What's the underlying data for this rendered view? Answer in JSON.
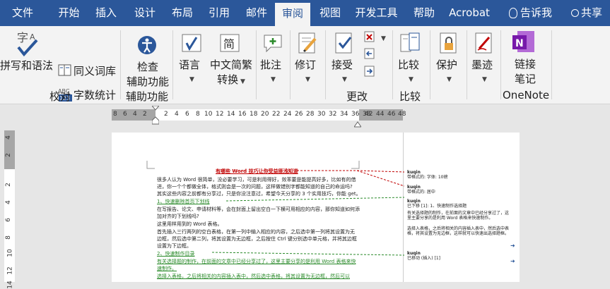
{
  "tabs": [
    {
      "label": "文件",
      "active": false
    },
    {
      "label": "开始",
      "active": false
    },
    {
      "label": "插入",
      "active": false
    },
    {
      "label": "设计",
      "active": false
    },
    {
      "label": "布局",
      "active": false
    },
    {
      "label": "引用",
      "active": false
    },
    {
      "label": "邮件",
      "active": false
    },
    {
      "label": "审阅",
      "active": true
    },
    {
      "label": "视图",
      "active": false
    },
    {
      "label": "开发工具",
      "active": false
    },
    {
      "label": "帮助",
      "active": false
    },
    {
      "label": "Acrobat",
      "active": false
    }
  ],
  "tell_me": "告诉我",
  "share": "共享",
  "ribbon": {
    "proofing": {
      "spelling": "拼写和语法",
      "thesaurus": "同义词库",
      "word_count": "字数统计",
      "group": "校对"
    },
    "accessibility": {
      "check_line1": "检查",
      "check_line2": "辅助功能",
      "group": "辅助功能"
    },
    "language": {
      "label": "语言"
    },
    "chinese": {
      "line1": "中文简繁",
      "line2": "转换"
    },
    "comments": {
      "label": "批注"
    },
    "tracking": {
      "label": "修订"
    },
    "changes": {
      "accept": "接受",
      "group": "更改"
    },
    "compare": {
      "label": "比较",
      "group": "比较"
    },
    "protect": {
      "label": "保护"
    },
    "ink": {
      "label": "墨迹"
    },
    "onenote": {
      "line1": "链接",
      "line2": "笔记",
      "group": "OneNote"
    }
  },
  "ruler": {
    "numbers": [
      "8",
      "6",
      "4",
      "2",
      "2",
      "4",
      "6",
      "8",
      "10",
      "12",
      "14",
      "16",
      "18",
      "20",
      "22",
      "24",
      "26",
      "28",
      "30",
      "32",
      "34",
      "36",
      "38",
      "42",
      "44",
      "46",
      "48"
    ]
  },
  "vruler": {
    "numbers": [
      "4",
      "2",
      "2",
      "4",
      "6",
      "8",
      "10",
      "12",
      "14"
    ]
  },
  "document": {
    "title": "有哪些 Word 技巧让你受益匪浅知道",
    "lines": [
      "很多人认为 Word 很简单，没必要学习，可是利用得好，效率要是能提高好多，比如有的借",
      "进，你一个个都做全体，格式则会是一次的问题，这样做错别字都能知道的自己的命运吗?",
      "其实这些内容之前都有分享过，只是你没注意过，希望今天分享的 3 个实用技巧，你能 get。",
      "1、快速删除首页下划线",
      "在写报告、论文、申请材料等，会在封面上留出空白一下横可用相应的内容，那你知道如何添",
      "加对齐的下划线吗?",
      "这里用样用到的 Word 表格。",
      "首先插入三行两列的空白表格，在第一列中输入相应的内容，之后选中第一列将其设置为无",
      "边框，然后选中第二列，将其设置为无边框，之后按住 Ctrl 键分别选中单元格，并将其边框",
      "设置为下边框。",
      "2、快速制作目录",
      "有关选择题的制作，在前面的文章中已经分享过了，这里主要分享的是利用 Word 表格来快",
      "速制作。",
      "选择入表格，之后将相关的内容插入表中，然后选中表格，将其设置为无边框，然后可以"
    ]
  },
  "markup": {
    "balloons": [
      {
        "author": "kuqin",
        "text": "带格式的: 字体: 10磅"
      },
      {
        "author": "kuqin",
        "text": "带格式的: 居中"
      },
      {
        "author": "kuqin",
        "text": "已下移 [1]: 1、快速制作选择题"
      },
      {
        "author": "",
        "text": "有关选择题的制作，在前面的文章中已经分享过了，这里主要分享的是利用 Word 表格来快速制作。"
      },
      {
        "author": "",
        "text": "选择入表格，之后将相关的内容插入表中，然后选中表格，将其设置为无边框，这样就可以快速出选择题框。"
      },
      {
        "author": "kuqin",
        "text": "已移动 (插入) [1]"
      }
    ]
  },
  "colors": {
    "accent": "#2b579a",
    "onenote": "#7719aa",
    "markup_red": "#c00000"
  }
}
